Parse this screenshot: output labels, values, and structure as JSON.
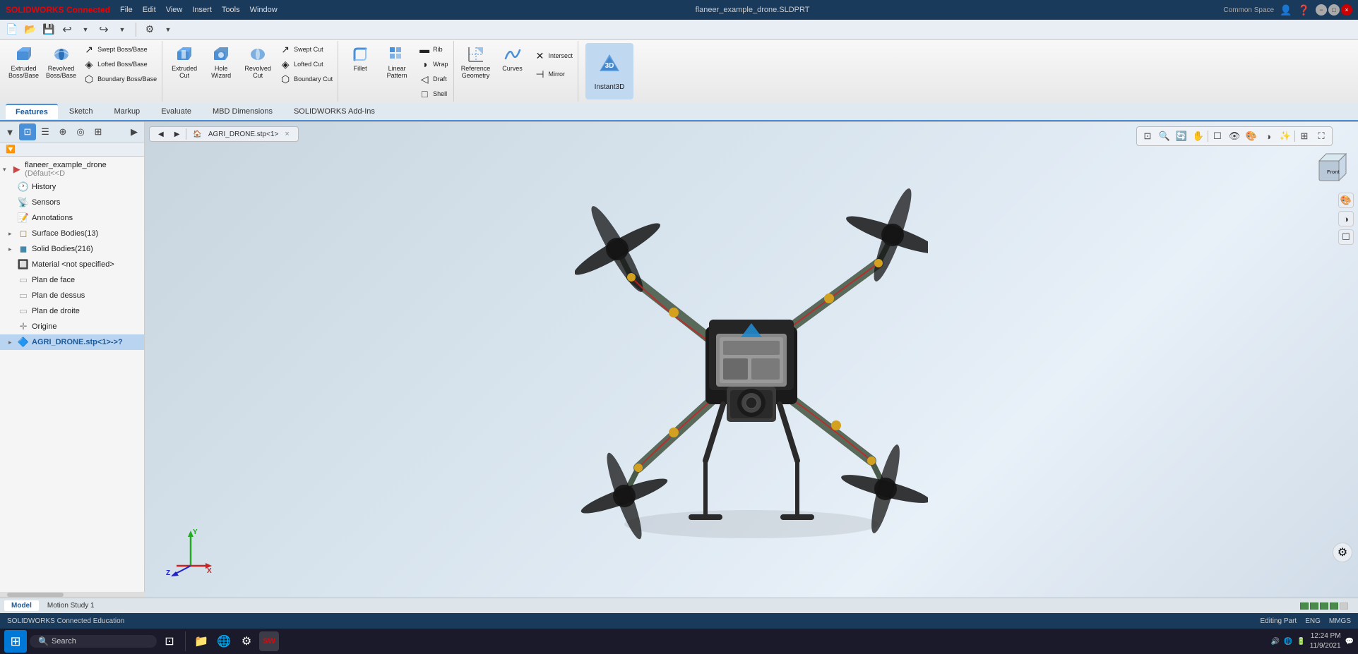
{
  "titlebar": {
    "logo": "SOLIDWORKS Connected",
    "menu": [
      "File",
      "Edit",
      "View",
      "Insert",
      "Tools",
      "Window"
    ],
    "title": "flaneer_example_drone.SLDPRT",
    "workspace": "Common Space",
    "win_buttons": [
      "−",
      "□",
      "×"
    ]
  },
  "ribbon": {
    "groups": [
      {
        "name": "boss-group",
        "large_tools": [
          {
            "id": "extruded-boss",
            "label": "Extruded\nBoss/Base",
            "icon": "⬛"
          },
          {
            "id": "revolved-boss",
            "label": "Revolved\nBoss/Base",
            "icon": "🔄"
          }
        ],
        "small_tools": [
          {
            "id": "swept-boss",
            "label": "Swept Boss/Base",
            "icon": "↗"
          },
          {
            "id": "lofted-boss",
            "label": "Lofted Boss/Base",
            "icon": "◈"
          },
          {
            "id": "boundary-boss",
            "label": "Boundary Boss/Base",
            "icon": "⬡"
          }
        ]
      },
      {
        "name": "cut-group",
        "large_tools": [
          {
            "id": "extruded-cut",
            "label": "Extruded\nCut",
            "icon": "⬛"
          },
          {
            "id": "hole-wizard",
            "label": "Hole\nWizard",
            "icon": "⭕"
          },
          {
            "id": "revolved-cut",
            "label": "Revolved\nCut",
            "icon": "🔄"
          }
        ],
        "small_tools": [
          {
            "id": "swept-cut",
            "label": "Swept Cut",
            "icon": "↗"
          },
          {
            "id": "lofted-cut",
            "label": "Lofted Cut",
            "icon": "◈"
          },
          {
            "id": "boundary-cut",
            "label": "Boundary Cut",
            "icon": "⬡"
          }
        ]
      },
      {
        "name": "features-group",
        "large_tools": [
          {
            "id": "fillet",
            "label": "Fillet",
            "icon": "⌒"
          },
          {
            "id": "linear-pattern",
            "label": "Linear\nPattern",
            "icon": "⊞"
          }
        ],
        "small_tools": [
          {
            "id": "rib",
            "label": "Rib",
            "icon": "▬"
          },
          {
            "id": "wrap",
            "label": "Wrap",
            "icon": "◑"
          },
          {
            "id": "draft",
            "label": "Draft",
            "icon": "◁"
          },
          {
            "id": "shell",
            "label": "Shell",
            "icon": "□"
          }
        ]
      },
      {
        "name": "tools-group",
        "large_tools": [
          {
            "id": "reference-geometry",
            "label": "Reference\nGeometry",
            "icon": "📐"
          },
          {
            "id": "curves",
            "label": "Curves",
            "icon": "〜"
          }
        ],
        "small_tools": [
          {
            "id": "intersect",
            "label": "Intersect",
            "icon": "✕"
          },
          {
            "id": "mirror",
            "label": "Mirror",
            "icon": "⊣"
          }
        ]
      },
      {
        "name": "instant3d",
        "label": "Instant3D",
        "icon": "⚡"
      }
    ]
  },
  "tabs": {
    "items": [
      "Features",
      "Sketch",
      "Markup",
      "Evaluate",
      "MBD Dimensions",
      "SOLIDWORKS Add-Ins"
    ],
    "active": "Features"
  },
  "qat": {
    "buttons": [
      {
        "id": "new",
        "icon": "📄"
      },
      {
        "id": "open",
        "icon": "📂"
      },
      {
        "id": "save",
        "icon": "💾"
      },
      {
        "id": "print",
        "icon": "🖨"
      },
      {
        "id": "undo",
        "icon": "↩"
      },
      {
        "id": "redo",
        "icon": "↪"
      },
      {
        "id": "options",
        "icon": "⚙"
      }
    ]
  },
  "panel": {
    "toolbar_buttons": [
      {
        "id": "filter",
        "icon": "🔽",
        "active": false
      },
      {
        "id": "view1",
        "icon": "⊡",
        "active": true
      },
      {
        "id": "view2",
        "icon": "☰",
        "active": false
      },
      {
        "id": "view3",
        "icon": "⊕",
        "active": false
      },
      {
        "id": "view4",
        "icon": "◎",
        "active": false
      },
      {
        "id": "more",
        "icon": "▶",
        "active": false
      }
    ],
    "filter_icon": "🔽"
  },
  "feature_tree": {
    "root": {
      "label": "flaneer_example_drone",
      "detail": "(Défaut<<D",
      "expanded": true
    },
    "items": [
      {
        "id": "history",
        "label": "History",
        "icon": "🕐",
        "indent": 1,
        "has_children": false
      },
      {
        "id": "sensors",
        "label": "Sensors",
        "icon": "📡",
        "indent": 1,
        "has_children": false
      },
      {
        "id": "annotations",
        "label": "Annotations",
        "icon": "📝",
        "indent": 1,
        "has_children": false
      },
      {
        "id": "surface-bodies",
        "label": "Surface Bodies(13)",
        "icon": "◻",
        "indent": 1,
        "has_children": true
      },
      {
        "id": "solid-bodies",
        "label": "Solid Bodies(216)",
        "icon": "◼",
        "indent": 1,
        "has_children": true
      },
      {
        "id": "material",
        "label": "Material <not specified>",
        "icon": "🔲",
        "indent": 1,
        "has_children": false
      },
      {
        "id": "plan-face",
        "label": "Plan de face",
        "icon": "▭",
        "indent": 1,
        "has_children": false
      },
      {
        "id": "plan-dessus",
        "label": "Plan de dessus",
        "icon": "▭",
        "indent": 1,
        "has_children": false
      },
      {
        "id": "plan-droite",
        "label": "Plan de droite",
        "icon": "▭",
        "indent": 1,
        "has_children": false
      },
      {
        "id": "origine",
        "label": "Origine",
        "icon": "✛",
        "indent": 1,
        "has_children": false
      },
      {
        "id": "agri-drone",
        "label": "AGRI_DRONE.stp<1>->?",
        "icon": "🔷",
        "indent": 1,
        "has_children": true,
        "selected": true
      }
    ]
  },
  "viewport": {
    "breadcrumb_icon": "🏠",
    "breadcrumb_back": "◀",
    "breadcrumb_forward": "▶",
    "breadcrumb_item": "AGRI_DRONE.stp<1>",
    "view_buttons": [
      "🔍",
      "🔎",
      "⊡",
      "⊞",
      "☰",
      "⬡",
      "⚙",
      "◑",
      "🎨",
      "⊕",
      "◻",
      "⊣"
    ],
    "axes_label": "Axes"
  },
  "right_toolbar": {
    "buttons": [
      {
        "id": "view-settings",
        "icon": "⚙"
      }
    ]
  },
  "bottom": {
    "tabs": [
      "Model",
      "Motion Study 1"
    ],
    "active_tab": "Model"
  },
  "statusbar": {
    "left_text": "SOLIDWORKS Connected Education",
    "progress_blocks": 5,
    "editing": "Editing Part",
    "locale": "MMGS",
    "keyboard": "ENG"
  },
  "taskbar": {
    "start_icon": "⊞",
    "search_placeholder": "Search",
    "app_icons": [
      {
        "id": "task-view",
        "icon": "⊡"
      },
      {
        "id": "file-explorer",
        "icon": "📁"
      },
      {
        "id": "chrome",
        "icon": "🌐"
      },
      {
        "id": "settings",
        "icon": "⚙"
      },
      {
        "id": "solidworks",
        "icon": "🔧"
      }
    ],
    "tray_icons": [
      "🔊",
      "🌐",
      "🔋"
    ],
    "time": "12:24 PM",
    "date": "11/9/2021",
    "notification_count": ""
  }
}
